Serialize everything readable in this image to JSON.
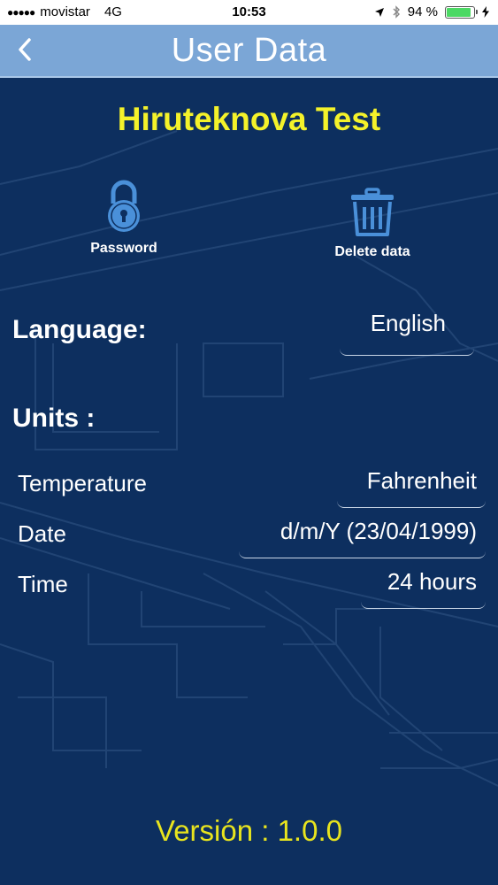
{
  "status_bar": {
    "signal": "●●●●●",
    "carrier": "movistar",
    "network": "4G",
    "time": "10:53",
    "battery": "94 %",
    "battery_level": 0.94
  },
  "nav": {
    "title": "User Data",
    "back_icon": "chevron-left-icon"
  },
  "app_title": "Hiruteknova Test",
  "actions": {
    "password": {
      "label": "Password",
      "icon": "lock-icon"
    },
    "delete": {
      "label": "Delete data",
      "icon": "trash-icon"
    }
  },
  "language": {
    "label": "Language:",
    "value": "English"
  },
  "units": {
    "label": "Units :",
    "temperature": {
      "label": "Temperature",
      "value": "Fahrenheit"
    },
    "date": {
      "label": "Date",
      "value": "d/m/Y (23/04/1999)"
    },
    "time": {
      "label": "Time",
      "value": "24 hours"
    }
  },
  "version": "Versión : 1.0.0",
  "colors": {
    "background": "#0d2f5f",
    "nav": "#7ba6d6",
    "title_yellow": "#f4f22a",
    "icon_blue": "#4a90d9"
  }
}
